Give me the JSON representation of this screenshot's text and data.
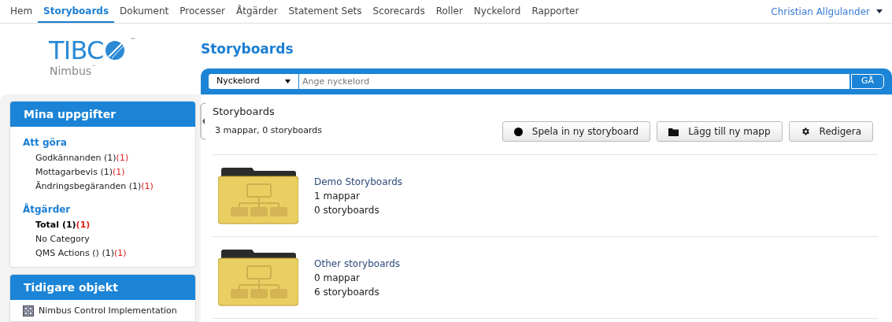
{
  "nav": {
    "items": [
      {
        "label": "Hem",
        "selected": false
      },
      {
        "label": "Storyboards",
        "selected": true
      },
      {
        "label": "Dokument",
        "selected": false
      },
      {
        "label": "Processer",
        "selected": false
      },
      {
        "label": "Åtgärder",
        "selected": false
      },
      {
        "label": "Statement Sets",
        "selected": false
      },
      {
        "label": "Scorecards",
        "selected": false
      },
      {
        "label": "Roller",
        "selected": false
      },
      {
        "label": "Nyckelord",
        "selected": false
      },
      {
        "label": "Rapporter",
        "selected": false
      }
    ],
    "user": "Christian Allgulander"
  },
  "logo": {
    "name": "TIBC",
    "product": "Nimbus",
    "trademark": "™",
    "product_trademark": "™"
  },
  "page_title": "Storyboards",
  "search": {
    "scope": "Nyckelord",
    "placeholder": "Ange nyckelord",
    "button": "GÅ"
  },
  "tasks": {
    "title": "Mina uppgifter",
    "groups": [
      {
        "heading": "Att göra",
        "items": [
          {
            "label": "Godkännanden",
            "count": "(1)",
            "overdue": "(1)",
            "bold": false
          },
          {
            "label": "Mottagarbevis",
            "count": "(1)",
            "overdue": "(1)",
            "bold": false
          },
          {
            "label": "Ändringsbegäranden",
            "count": "(1)",
            "overdue": "(1)",
            "bold": false
          }
        ]
      },
      {
        "heading": "Åtgärder",
        "items": [
          {
            "label": "Total",
            "count": "(1)",
            "overdue": "(1)",
            "bold": true
          },
          {
            "label": "No Category",
            "bold": false
          },
          {
            "label": "QMS Actions ()",
            "count": "(1)",
            "overdue": "(1)",
            "bold": false
          }
        ]
      }
    ]
  },
  "recent": {
    "title": "Tidigare objekt",
    "items": [
      "Nimbus Control Implementation"
    ]
  },
  "content": {
    "heading": "Storyboards",
    "summary": "3 mappar, 0 storyboards",
    "buttons": [
      {
        "kind": "record",
        "label": "Spela in ny storyboard"
      },
      {
        "kind": "folder",
        "label": "Lägg till ny mapp"
      },
      {
        "kind": "settings",
        "label": "Redigera"
      }
    ],
    "folders": [
      {
        "name": "Demo Storyboards",
        "folders": "1 mappar",
        "storyboards": "0 storyboards"
      },
      {
        "name": "Other storyboards",
        "folders": "0 mappar",
        "storyboards": "6 storyboards"
      }
    ]
  }
}
